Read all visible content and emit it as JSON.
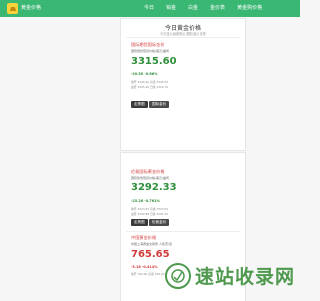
{
  "nav": {
    "brand": "黄金价格",
    "menu": [
      "今日",
      "铂金",
      "白金",
      "金价表",
      "黄金购价格"
    ]
  },
  "card_top": {
    "title": "今日黄金价格",
    "subtitle": "今天金价最新报价/国际金价走势",
    "section": {
      "name": "国际期货国际金价",
      "desc": "国际纽约现货价格/美元/盎司",
      "price": "3315.60",
      "change": "-20.50 -0.66%",
      "meta1": "收开 3345.20 高盘 3345.50",
      "meta2": "最低 3305.40 日落 3314.70"
    },
    "buttons": [
      "走势图",
      "国际金价"
    ]
  },
  "card_bottom": {
    "section1": {
      "name": "伦敦国际黄金价格",
      "desc": "国际伦敦现货价格/美元/盎司",
      "price": "3292.33",
      "change": "-25.26 -0.761%",
      "meta1": "收开 3323.93 高盘 3323.93",
      "meta2": "最低 3290.88 日落 3291.20"
    },
    "buttons": [
      "走势图",
      "伦敦金价"
    ],
    "section2": {
      "name": "中国黄金价格",
      "desc": "中国上海黄金交易所 人民币/克",
      "price": "765.65",
      "change": "-3.16 -0.414%",
      "meta1": "收开 769.00 高盘 769.20"
    }
  },
  "watermark": {
    "text": "速站收录网"
  },
  "colors": {
    "nav": "#3bb774",
    "price_red": "#d23a3a",
    "price_green": "#2f8f3a",
    "watermark": "#3c8f3c"
  }
}
